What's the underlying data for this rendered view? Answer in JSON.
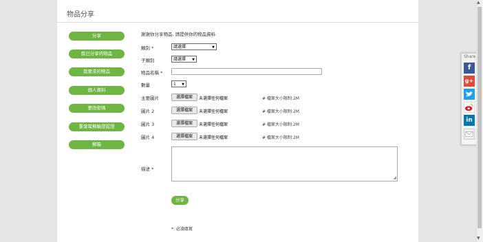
{
  "header": {
    "title": "物品分享"
  },
  "sidebar": {
    "items": [
      {
        "label": "分享"
      },
      {
        "label": "我已分享的物品"
      },
      {
        "label": "我要求的物品"
      },
      {
        "label": "個人資料"
      },
      {
        "label": "更改密碼"
      },
      {
        "label": "重發電郵驗證認證"
      },
      {
        "label": "郵箱"
      }
    ]
  },
  "form": {
    "intro": "謝謝你分享物品, 請提供你的物品資料",
    "category": {
      "label": "類別 *",
      "value": "請選擇"
    },
    "subcategory": {
      "label": "子類別",
      "value": "請選擇"
    },
    "item_name": {
      "label": "物品名稱 *",
      "value": ""
    },
    "quantity": {
      "label": "數量",
      "value": "1"
    },
    "images": [
      {
        "label": "主要圖片",
        "button": "選擇檔案",
        "status": "未選擇任何檔案",
        "note": "# 檔案大小限制:2M"
      },
      {
        "label": "圖片 2",
        "button": "選擇檔案",
        "status": "未選擇任何檔案",
        "note": "# 檔案大小限制:2M"
      },
      {
        "label": "圖片 3",
        "button": "選擇檔案",
        "status": "未選擇任何檔案",
        "note": "# 檔案大小限制:2M"
      },
      {
        "label": "圖片 4",
        "button": "選擇檔案",
        "status": "未選擇任何檔案",
        "note": "# 檔案大小限制:2M"
      }
    ],
    "description": {
      "label": "描述 *",
      "value": ""
    },
    "submit_label": "分享",
    "required_note": "*: 必須填寫"
  },
  "share": {
    "label": "Share",
    "icons": [
      "facebook-icon",
      "google-plus-icon",
      "twitter-icon",
      "weibo-icon",
      "linkedin-icon",
      "email-icon"
    ]
  },
  "colors": {
    "accent": "#6fb543",
    "facebook": "#3b5998",
    "google_plus": "#dd4b39",
    "twitter": "#1da1f2",
    "linkedin": "#0077b5"
  }
}
